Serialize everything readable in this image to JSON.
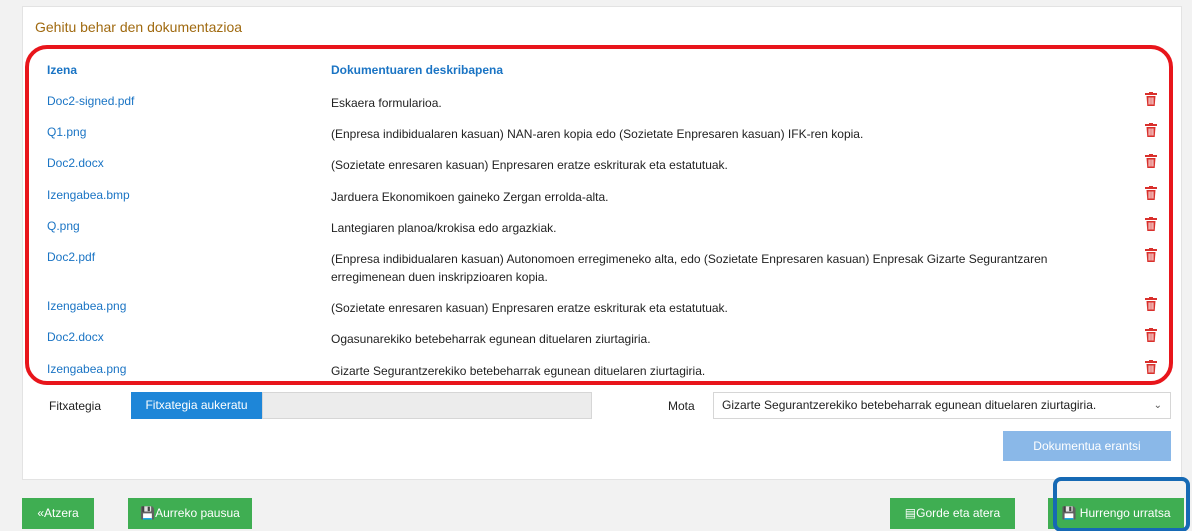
{
  "panel_title": "Gehitu behar den dokumentazioa",
  "table": {
    "headers": [
      "Izena",
      "Dokumentuaren deskribapena"
    ],
    "rows": [
      {
        "name": "Doc2-signed.pdf",
        "desc": "Eskaera formularioa."
      },
      {
        "name": "Q1.png",
        "desc": "(Enpresa indibidualaren kasuan) NAN-aren kopia edo (Sozietate Enpresaren kasuan) IFK-ren kopia."
      },
      {
        "name": "Doc2.docx",
        "desc": "(Sozietate enresaren kasuan) Enpresaren eratze eskriturak eta estatutuak."
      },
      {
        "name": "Izengabea.bmp",
        "desc": "Jarduera Ekonomikoen gaineko Zergan errolda-alta."
      },
      {
        "name": "Q.png",
        "desc": "Lantegiaren planoa/krokisa edo argazkiak."
      },
      {
        "name": "Doc2.pdf",
        "desc": "(Enpresa indibidualaren kasuan) Autonomoen erregimeneko alta, edo (Sozietate Enpresaren kasuan) Enpresak Gizarte Segurantzaren erregimenean duen inskripzioaren kopia."
      },
      {
        "name": "Izengabea.png",
        "desc": "(Sozietate enresaren kasuan) Enpresaren eratze eskriturak eta estatutuak."
      },
      {
        "name": "Doc2.docx",
        "desc": "Ogasunarekiko betebeharrak egunean dituelaren ziurtagiria."
      },
      {
        "name": "Izengabea.png",
        "desc": "Gizarte Segurantzerekiko betebeharrak egunean dituelaren ziurtagiria."
      }
    ]
  },
  "upload": {
    "file_label": "Fitxategia",
    "choose_button": "Fitxategia aukeratu",
    "file_name": "",
    "type_label": "Mota",
    "type_selected": "Gizarte Segurantzerekiko betebeharrak egunean dituelaren ziurtagiria.",
    "attach_button": "Dokumentua erantsi"
  },
  "footer": {
    "back": "Atzera",
    "prev_step": "Aurreko pausua",
    "save_exit": "Gorde eta atera",
    "next_step": "Hurrengo urratsa"
  },
  "colors": {
    "link": "#1a74c4",
    "trash": "#d9302c",
    "green": "#3fae52",
    "primary": "#1e86d8",
    "highlight_red": "#e8151b",
    "highlight_blue": "#1669b4"
  }
}
